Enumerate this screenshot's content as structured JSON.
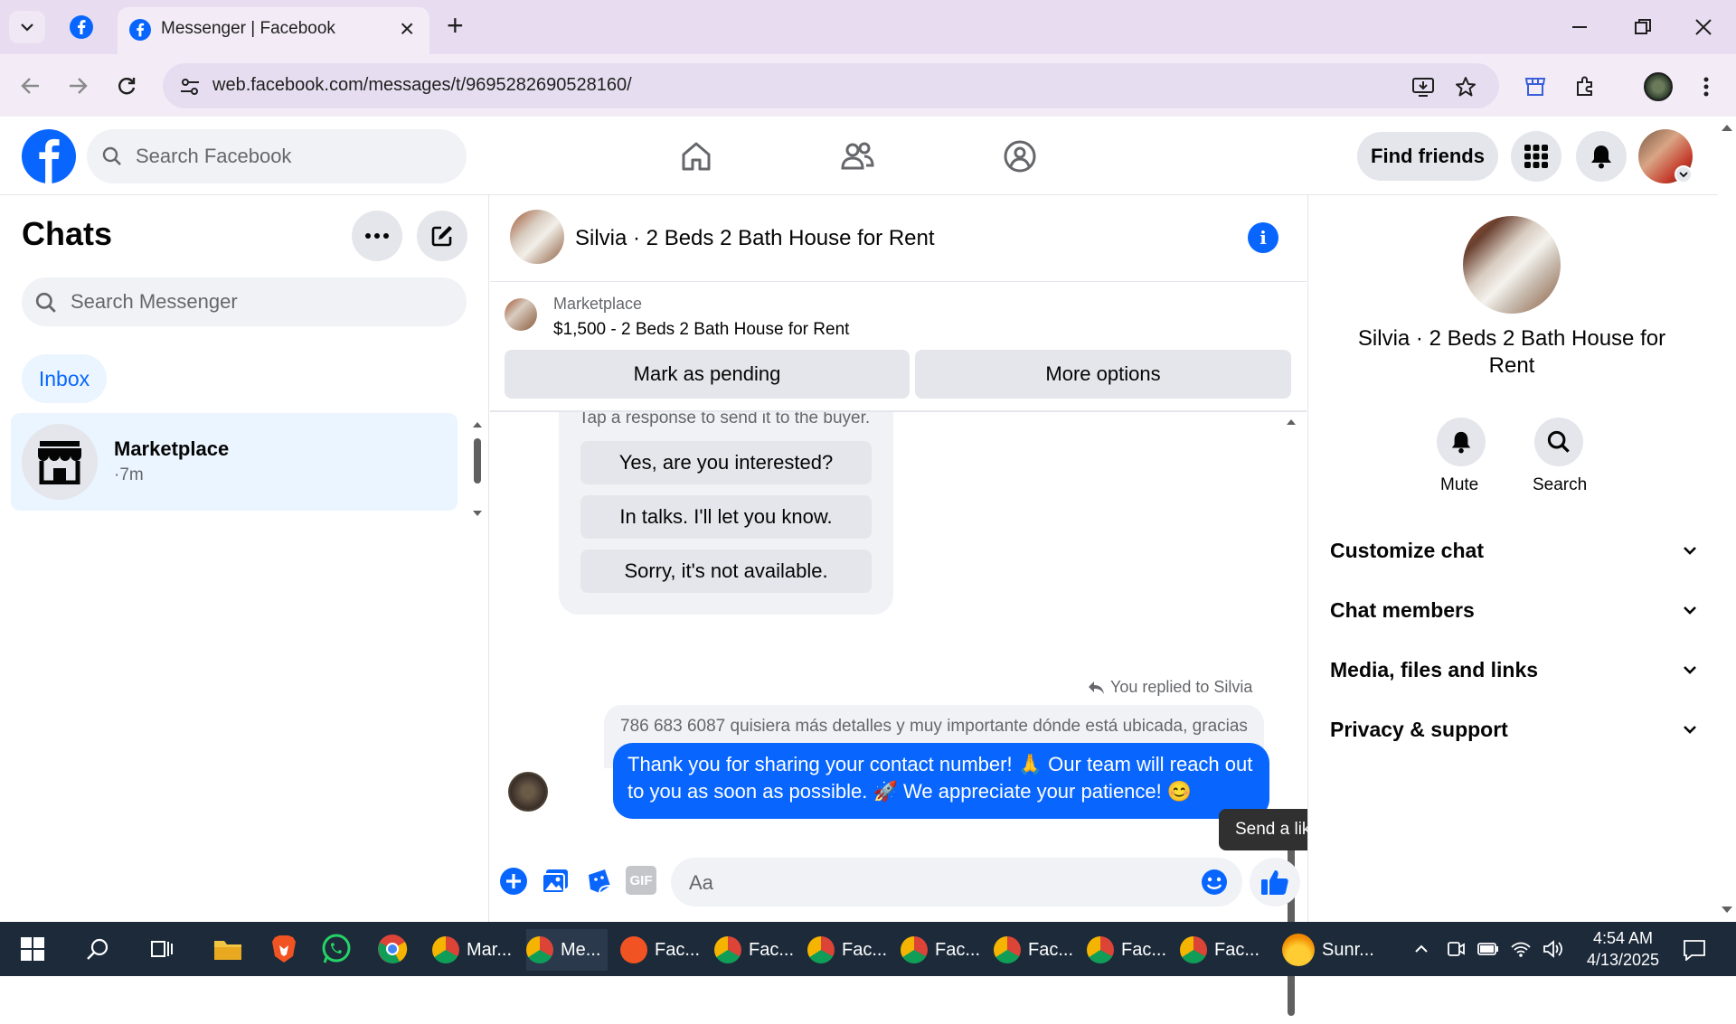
{
  "browser": {
    "tab_title": "Messenger | Facebook",
    "url": "web.facebook.com/messages/t/9695282690528160/",
    "new_tab": "+",
    "close_tab": "×"
  },
  "fb_header": {
    "search_placeholder": "Search Facebook",
    "find_friends": "Find friends"
  },
  "chats": {
    "title": "Chats",
    "search_placeholder": "Search Messenger",
    "filter_inbox": "Inbox",
    "items": [
      {
        "name": "Marketplace",
        "meta": "·7m"
      }
    ]
  },
  "conversation": {
    "title": "Silvia · 2 Beds 2 Bath House for Rent",
    "listing": {
      "source": "Marketplace",
      "summary": "$1,500 - 2 Beds 2 Bath House for Rent",
      "mark_pending": "Mark as pending",
      "more_options": "More options"
    },
    "suggestion_header": "Tap a response to send it to the buyer.",
    "quick_replies": [
      "Yes, are you interested?",
      "In talks. I'll let you know.",
      "Sorry, it's not available."
    ],
    "replied_label": "You replied to Silvia",
    "quoted": "786 683 6087 quisiera más detalles y muy importante dónde está ubicada, gracias",
    "sent": "Thank you for sharing your contact number! 🙏 Our team will reach out to you as soon as possible. 🚀 We appreciate your patience! 😊",
    "composer_placeholder": "Aa",
    "tooltip": "Send a like",
    "gif_label": "GIF"
  },
  "info_panel": {
    "name": "Silvia · 2 Beds 2 Bath House for Rent",
    "mute": "Mute",
    "search": "Search",
    "sections": [
      "Customize chat",
      "Chat members",
      "Media, files and links",
      "Privacy & support"
    ]
  },
  "taskbar": {
    "apps": [
      "Mar...",
      "Me...",
      "Fac...",
      "Fac...",
      "Fac...",
      "Fac...",
      "Fac...",
      "Fac...",
      "Fac..."
    ],
    "weather": "Sunr...",
    "time": "4:54 AM",
    "date": "4/13/2025"
  },
  "colors": {
    "fb_blue": "#0866ff",
    "chrome_tabstrip": "#e8dcf0",
    "selected_chat": "#ebf5ff"
  }
}
